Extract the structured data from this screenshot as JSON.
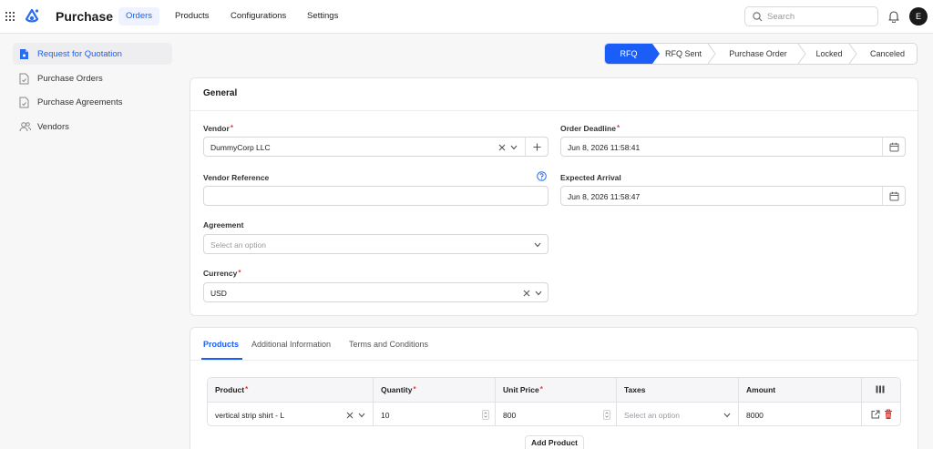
{
  "app": {
    "title": "Purchase",
    "avatar_initial": "E"
  },
  "topnav": {
    "items": [
      {
        "label": "Orders",
        "active": true
      },
      {
        "label": "Products",
        "active": false
      },
      {
        "label": "Configurations",
        "active": false
      },
      {
        "label": "Settings",
        "active": false
      }
    ],
    "search_placeholder": "Search"
  },
  "sidebar": {
    "items": [
      {
        "label": "Request for Quotation",
        "icon": "document-star-icon",
        "active": true
      },
      {
        "label": "Purchase Orders",
        "icon": "document-check-icon",
        "active": false
      },
      {
        "label": "Purchase Agreements",
        "icon": "document-check-icon",
        "active": false
      },
      {
        "label": "Vendors",
        "icon": "users-icon",
        "active": false
      }
    ]
  },
  "status_steps": [
    {
      "label": "RFQ",
      "active": true
    },
    {
      "label": "RFQ Sent",
      "active": false
    },
    {
      "label": "Purchase Order",
      "active": false
    },
    {
      "label": "Locked",
      "active": false
    },
    {
      "label": "Canceled",
      "active": false
    }
  ],
  "general": {
    "title": "General",
    "vendor": {
      "label": "Vendor",
      "required": "*",
      "value": "DummyCorp LLC"
    },
    "vendor_reference": {
      "label": "Vendor Reference",
      "value": ""
    },
    "agreement": {
      "label": "Agreement",
      "placeholder": "Select an option"
    },
    "currency": {
      "label": "Currency",
      "required": "*",
      "value": "USD"
    },
    "order_deadline": {
      "label": "Order Deadline",
      "required": "*",
      "value": "Jun 8, 2026 11:58:41"
    },
    "expected_arrival": {
      "label": "Expected Arrival",
      "value": "Jun 8, 2026 11:58:47"
    }
  },
  "tabs": [
    {
      "label": "Products",
      "active": true
    },
    {
      "label": "Additional Information",
      "active": false
    },
    {
      "label": "Terms and Conditions",
      "active": false
    }
  ],
  "products_table": {
    "columns": [
      {
        "label": "Product",
        "required": "*"
      },
      {
        "label": "Quantity",
        "required": "*"
      },
      {
        "label": "Unit Price",
        "required": "*"
      },
      {
        "label": "Taxes",
        "required": ""
      },
      {
        "label": "Amount",
        "required": ""
      }
    ],
    "rows": [
      {
        "product": "vertical strip shirt - L",
        "quantity": "10",
        "unit_price": "800",
        "taxes_placeholder": "Select an option",
        "amount": "8000"
      }
    ],
    "add_label": "Add Product"
  },
  "colors": {
    "accent": "#1b5ef7",
    "required": "#e23b3b",
    "delete": "#e02424"
  }
}
